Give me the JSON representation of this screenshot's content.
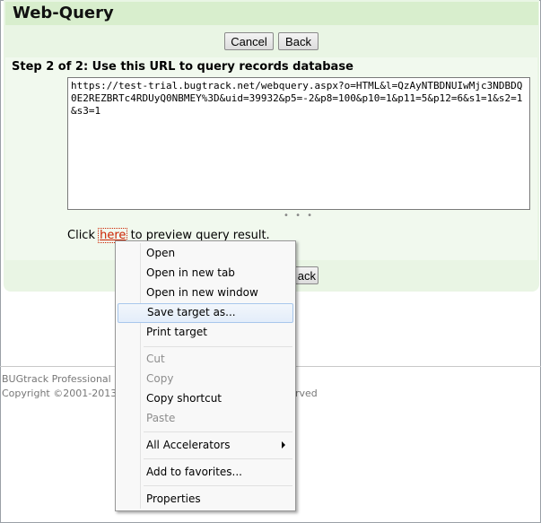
{
  "page": {
    "title": "Web-Query",
    "cancel_label": "Cancel",
    "back_label": "Back",
    "step_heading": "Step 2 of 2: Use this URL to query records database",
    "url_value": "https://test-trial.bugtrack.net/webquery.aspx?o=HTML&l=QzAyNTBDNUIwMjc3NDBDQ0E2REZBRTc4RDUyQ0NBMEY%3D&uid=39932&p5=-2&p8=100&p10=1&p11=5&p12=6&s1=1&s2=1&s3=1",
    "click_prefix": "Click",
    "here_link": "here",
    "click_suffix": "to preview query result.",
    "bottom_back_partial": "ack"
  },
  "footer": {
    "line1_partial": "BUGtrack Professional E",
    "line2_partial": "Copyright ©2001-2013",
    "line2_right_partial": "rved"
  },
  "context_menu": {
    "items": [
      {
        "label": "Open",
        "disabled": false
      },
      {
        "label": "Open in new tab",
        "disabled": false
      },
      {
        "label": "Open in new window",
        "disabled": false
      },
      {
        "label": "Save target as...",
        "disabled": false,
        "highlighted": true
      },
      {
        "label": "Print target",
        "disabled": false
      },
      {
        "label": "Cut",
        "disabled": true
      },
      {
        "label": "Copy",
        "disabled": true
      },
      {
        "label": "Copy shortcut",
        "disabled": false
      },
      {
        "label": "Paste",
        "disabled": true
      },
      {
        "label": "All Accelerators",
        "disabled": false,
        "submenu": true
      },
      {
        "label": "Add to favorites...",
        "disabled": false
      },
      {
        "label": "Properties",
        "disabled": false
      }
    ]
  },
  "colors": {
    "panel_bg": "#e9f5e4",
    "title_bg": "#d8eecd",
    "link": "#cc2200",
    "menu_highlight_border": "#a8c7ec"
  }
}
